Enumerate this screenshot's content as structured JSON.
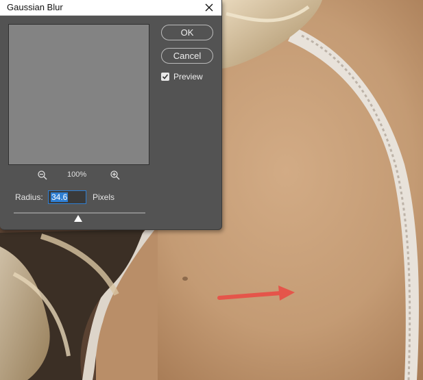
{
  "dialog": {
    "title": "Gaussian Blur",
    "ok_label": "OK",
    "cancel_label": "Cancel",
    "preview_label": "Preview",
    "preview_checked": true,
    "zoom_level": "100%",
    "radius_label": "Radius:",
    "radius_value": "34.6",
    "radius_unit": "Pixels",
    "slider_level": 0.49
  },
  "icons": {
    "close": "close-icon",
    "zoom_out": "zoom-out-icon",
    "zoom_in": "zoom-in-icon",
    "checkmark": "checkmark-icon"
  },
  "colors": {
    "dialog_bg": "#535353",
    "accent": "#2f7fd3",
    "annotation_arrow": "#e5554a",
    "skin": "#c9a07a"
  }
}
